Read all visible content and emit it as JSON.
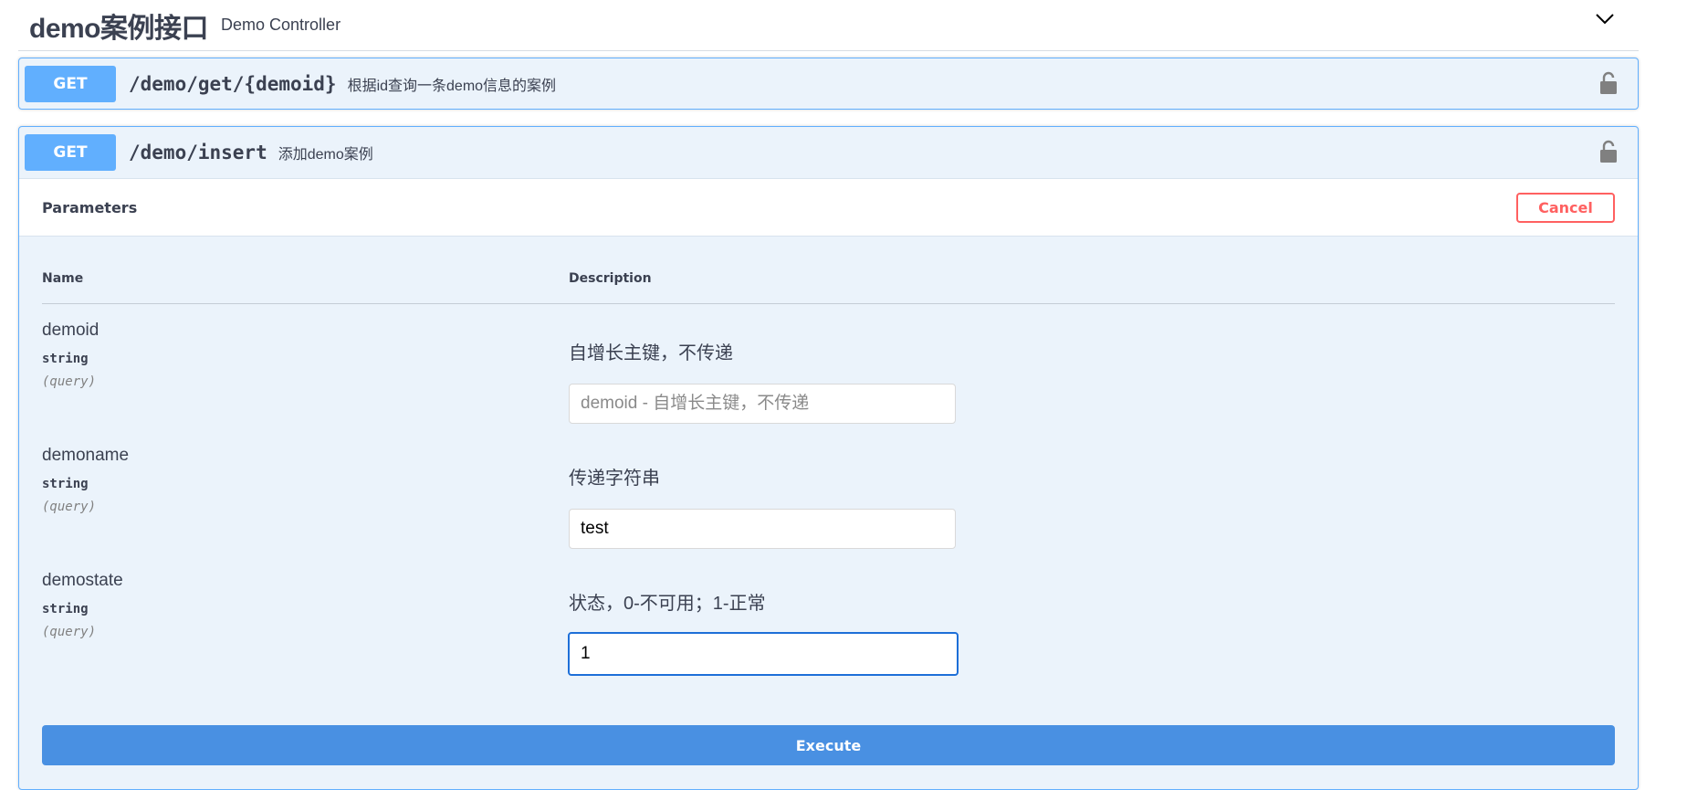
{
  "tag": {
    "title": "demo案例接口",
    "description": "Demo Controller"
  },
  "operations": [
    {
      "method": "GET",
      "path": "/demo/get/{demoid}",
      "summary": "根据id查询一条demo信息的案例"
    },
    {
      "method": "GET",
      "path": "/demo/insert",
      "summary": "添加demo案例"
    }
  ],
  "parameters_panel": {
    "title": "Parameters",
    "cancel_label": "Cancel",
    "col_name": "Name",
    "col_description": "Description",
    "params": [
      {
        "name": "demoid",
        "type": "string",
        "in": "(query)",
        "description": "自增长主键，不传递",
        "value": "",
        "placeholder": "demoid - 自增长主键，不传递"
      },
      {
        "name": "demoname",
        "type": "string",
        "in": "(query)",
        "description": "传递字符串",
        "value": "test",
        "placeholder": ""
      },
      {
        "name": "demostate",
        "type": "string",
        "in": "(query)",
        "description": "状态，0-不可用；1-正常",
        "value": "1",
        "placeholder": ""
      }
    ],
    "execute_label": "Execute"
  },
  "colors": {
    "get_method": "#61affe",
    "execute": "#4990e2",
    "cancel": "#ff6060",
    "opblock_bg": "#ebf3fb"
  },
  "icons": [
    "chevron-down-icon",
    "lock-icon"
  ]
}
